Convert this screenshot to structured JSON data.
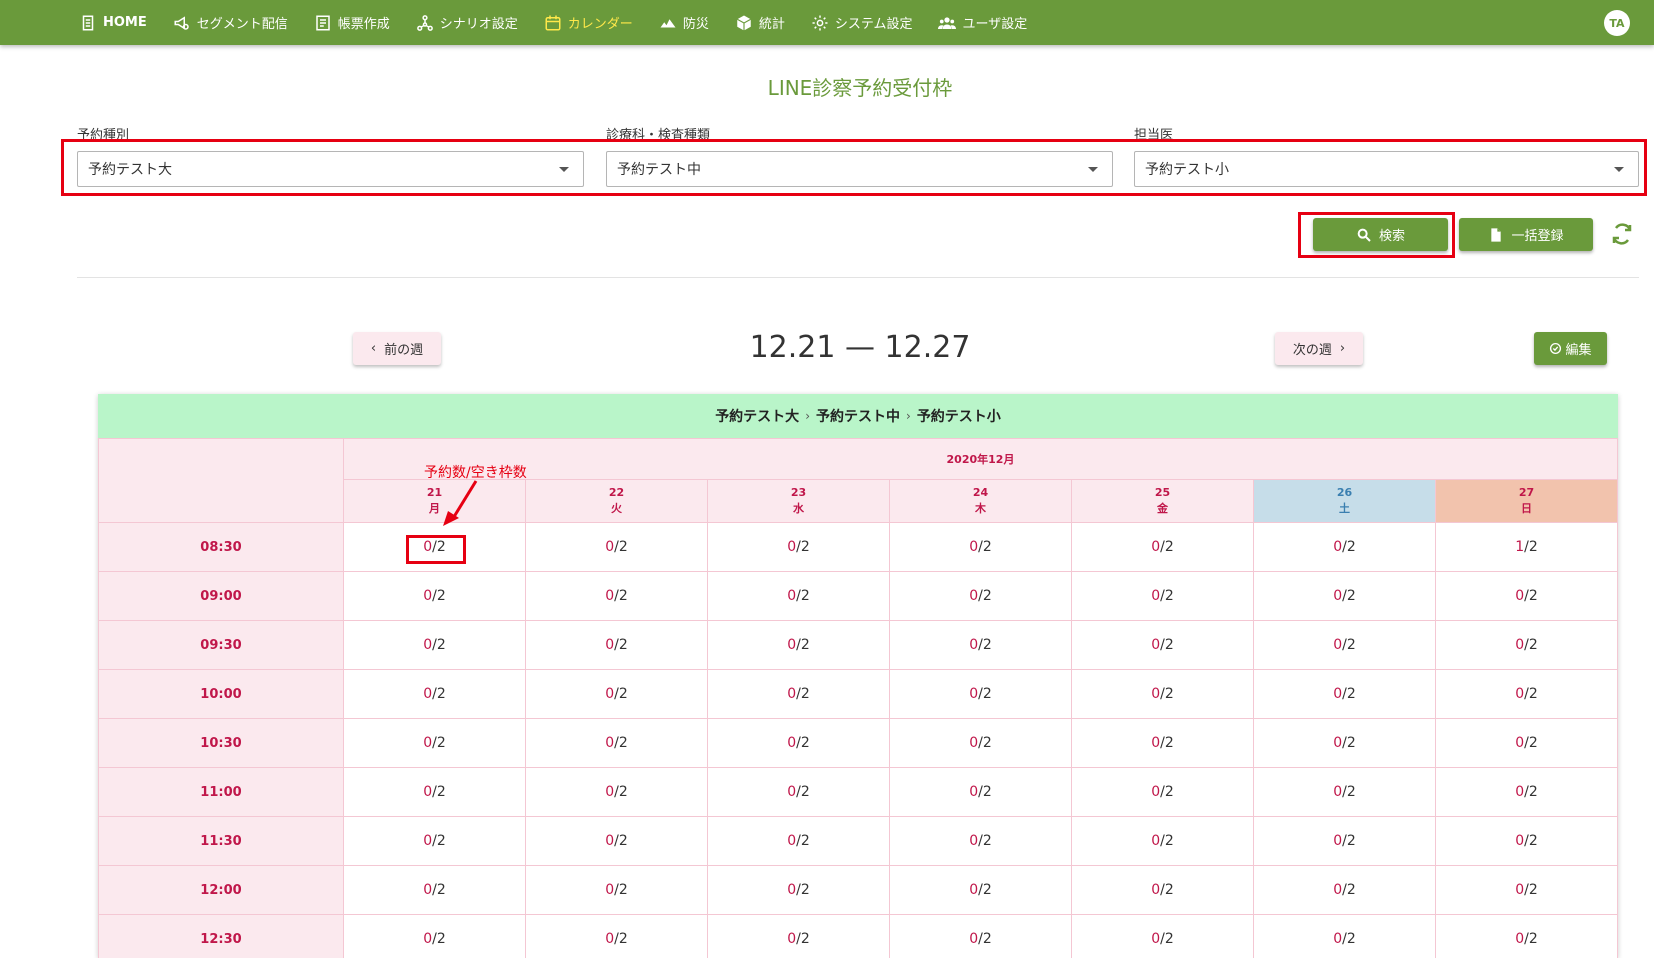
{
  "nav": {
    "items": [
      {
        "label": "HOME",
        "icon": "clipboard-icon"
      },
      {
        "label": "セグメント配信",
        "icon": "megaphone-icon"
      },
      {
        "label": "帳票作成",
        "icon": "document-icon"
      },
      {
        "label": "シナリオ設定",
        "icon": "network-icon"
      },
      {
        "label": "カレンダー",
        "icon": "calendar-icon"
      },
      {
        "label": "防災",
        "icon": "disaster-icon"
      },
      {
        "label": "統計",
        "icon": "box-icon"
      },
      {
        "label": "システム設定",
        "icon": "gear-icon"
      },
      {
        "label": "ユーザ設定",
        "icon": "users-icon"
      }
    ],
    "avatar": "TA"
  },
  "page": {
    "title": "LINE診察予約受付枠"
  },
  "filters": {
    "category": {
      "label": "予約種別",
      "value": "予約テスト大"
    },
    "department": {
      "label": "診療科・検査種類",
      "value": "予約テスト中"
    },
    "doctor": {
      "label": "担当医",
      "value": "予約テスト小"
    }
  },
  "actions": {
    "search": "検索",
    "bulk_register": "一括登録",
    "edit": "編集"
  },
  "week": {
    "prev": "前の週",
    "next": "次の週",
    "range": "12.21 — 12.27"
  },
  "calendar": {
    "breadcrumb": [
      "予約テスト大",
      "予約テスト中",
      "予約テスト小"
    ],
    "month": "2020年12月",
    "days": [
      {
        "date": "21",
        "weekday": "月"
      },
      {
        "date": "22",
        "weekday": "火"
      },
      {
        "date": "23",
        "weekday": "水"
      },
      {
        "date": "24",
        "weekday": "木"
      },
      {
        "date": "25",
        "weekday": "金"
      },
      {
        "date": "26",
        "weekday": "土"
      },
      {
        "date": "27",
        "weekday": "日"
      }
    ],
    "rows": [
      {
        "time": "08:30",
        "slots": [
          {
            "b": "0",
            "t": "/2"
          },
          {
            "b": "0",
            "t": "/2"
          },
          {
            "b": "0",
            "t": "/2"
          },
          {
            "b": "0",
            "t": "/2"
          },
          {
            "b": "0",
            "t": "/2"
          },
          {
            "b": "0",
            "t": "/2"
          },
          {
            "b": "1",
            "t": "/2"
          }
        ]
      },
      {
        "time": "09:00",
        "slots": [
          {
            "b": "0",
            "t": "/2"
          },
          {
            "b": "0",
            "t": "/2"
          },
          {
            "b": "0",
            "t": "/2"
          },
          {
            "b": "0",
            "t": "/2"
          },
          {
            "b": "0",
            "t": "/2"
          },
          {
            "b": "0",
            "t": "/2"
          },
          {
            "b": "0",
            "t": "/2"
          }
        ]
      },
      {
        "time": "09:30",
        "slots": [
          {
            "b": "0",
            "t": "/2"
          },
          {
            "b": "0",
            "t": "/2"
          },
          {
            "b": "0",
            "t": "/2"
          },
          {
            "b": "0",
            "t": "/2"
          },
          {
            "b": "0",
            "t": "/2"
          },
          {
            "b": "0",
            "t": "/2"
          },
          {
            "b": "0",
            "t": "/2"
          }
        ]
      },
      {
        "time": "10:00",
        "slots": [
          {
            "b": "0",
            "t": "/2"
          },
          {
            "b": "0",
            "t": "/2"
          },
          {
            "b": "0",
            "t": "/2"
          },
          {
            "b": "0",
            "t": "/2"
          },
          {
            "b": "0",
            "t": "/2"
          },
          {
            "b": "0",
            "t": "/2"
          },
          {
            "b": "0",
            "t": "/2"
          }
        ]
      },
      {
        "time": "10:30",
        "slots": [
          {
            "b": "0",
            "t": "/2"
          },
          {
            "b": "0",
            "t": "/2"
          },
          {
            "b": "0",
            "t": "/2"
          },
          {
            "b": "0",
            "t": "/2"
          },
          {
            "b": "0",
            "t": "/2"
          },
          {
            "b": "0",
            "t": "/2"
          },
          {
            "b": "0",
            "t": "/2"
          }
        ]
      },
      {
        "time": "11:00",
        "slots": [
          {
            "b": "0",
            "t": "/2"
          },
          {
            "b": "0",
            "t": "/2"
          },
          {
            "b": "0",
            "t": "/2"
          },
          {
            "b": "0",
            "t": "/2"
          },
          {
            "b": "0",
            "t": "/2"
          },
          {
            "b": "0",
            "t": "/2"
          },
          {
            "b": "0",
            "t": "/2"
          }
        ]
      },
      {
        "time": "11:30",
        "slots": [
          {
            "b": "0",
            "t": "/2"
          },
          {
            "b": "0",
            "t": "/2"
          },
          {
            "b": "0",
            "t": "/2"
          },
          {
            "b": "0",
            "t": "/2"
          },
          {
            "b": "0",
            "t": "/2"
          },
          {
            "b": "0",
            "t": "/2"
          },
          {
            "b": "0",
            "t": "/2"
          }
        ]
      },
      {
        "time": "12:00",
        "slots": [
          {
            "b": "0",
            "t": "/2"
          },
          {
            "b": "0",
            "t": "/2"
          },
          {
            "b": "0",
            "t": "/2"
          },
          {
            "b": "0",
            "t": "/2"
          },
          {
            "b": "0",
            "t": "/2"
          },
          {
            "b": "0",
            "t": "/2"
          },
          {
            "b": "0",
            "t": "/2"
          }
        ]
      },
      {
        "time": "12:30",
        "slots": [
          {
            "b": "0",
            "t": "/2"
          },
          {
            "b": "0",
            "t": "/2"
          },
          {
            "b": "0",
            "t": "/2"
          },
          {
            "b": "0",
            "t": "/2"
          },
          {
            "b": "0",
            "t": "/2"
          },
          {
            "b": "0",
            "t": "/2"
          },
          {
            "b": "0",
            "t": "/2"
          }
        ]
      }
    ]
  },
  "annotation": {
    "text": "予約数/空き枠数"
  },
  "colors": {
    "brand": "#6a9a3b",
    "active_nav": "#ffe84a",
    "header_green": "#b9f5c9",
    "pink": "#fbe9ee",
    "accent_red": "#c0174a",
    "saturday": "#c6dde9",
    "sunday": "#f2c3ad",
    "highlight": "#e60012"
  }
}
